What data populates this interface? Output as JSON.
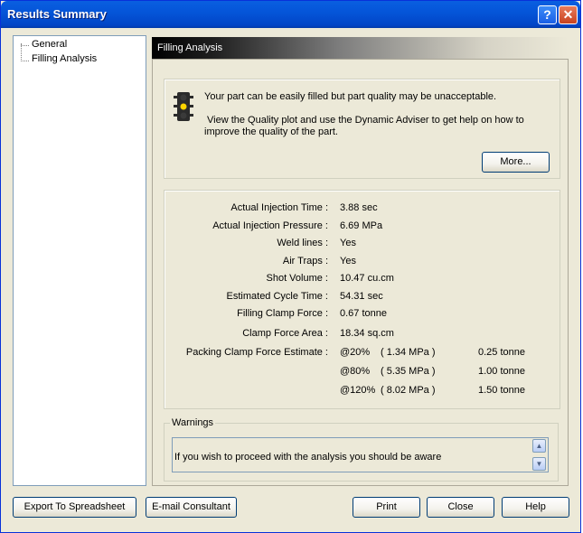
{
  "window": {
    "title": "Results Summary"
  },
  "tree": {
    "items": [
      {
        "label": "General"
      },
      {
        "label": "Filling Analysis"
      }
    ]
  },
  "panel": {
    "title": "Filling Analysis"
  },
  "message": {
    "line1": "Your part can be easily filled but part quality may be unacceptable.",
    "line2": "View the Quality plot and use the Dynamic Adviser to get help on how to",
    "line3": "improve the quality of the part.",
    "more_label": "More..."
  },
  "results": [
    {
      "label": "Actual Injection Time :",
      "value": "3.88 sec"
    },
    {
      "label": "Actual Injection Pressure :",
      "value": "6.69 MPa"
    },
    {
      "label": "Weld lines :",
      "value": "Yes"
    },
    {
      "label": "Air Traps :",
      "value": "Yes"
    },
    {
      "label": "Shot Volume :",
      "value": "10.47 cu.cm"
    },
    {
      "label": "Estimated Cycle Time :",
      "value": "54.31 sec"
    },
    {
      "label": "Filling Clamp Force :",
      "value": "0.67 tonne"
    },
    {
      "label": "Clamp Force Area :",
      "value": "18.34 sq.cm"
    }
  ],
  "packing": {
    "label": "Packing Clamp Force Estimate :",
    "rows": [
      {
        "pct": "@20%",
        "pressure": "( 1.34 MPa )",
        "force": "0.25 tonne"
      },
      {
        "pct": "@80%",
        "pressure": "( 5.35 MPa )",
        "force": "1.00 tonne"
      },
      {
        "pct": "@120%",
        "pressure": "( 8.02 MPa )",
        "force": "1.50 tonne"
      }
    ]
  },
  "warnings": {
    "legend": "Warnings",
    "text": "If you wish to proceed with the analysis you should be aware"
  },
  "buttons": {
    "export": "Export To Spreadsheet",
    "email": "E-mail Consultant",
    "print": "Print",
    "close": "Close",
    "help": "Help"
  },
  "colors": {
    "titlebar": "#0454d8",
    "dialog_bg": "#ece9d8"
  }
}
